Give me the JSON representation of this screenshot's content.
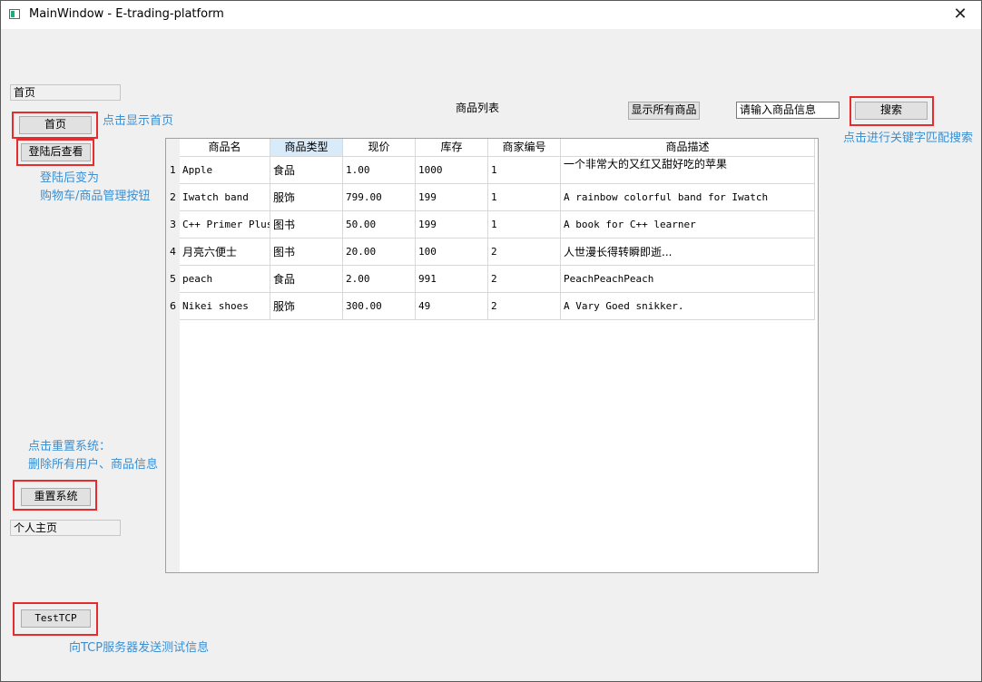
{
  "window": {
    "title": "MainWindow - E-trading-platform",
    "close_glyph": "✕"
  },
  "nav": {
    "home_group_label": "首页",
    "home_button": "首页",
    "login_view_button": "登陆后查看",
    "reset_button": "重置系统",
    "profile_group_label": "个人主页",
    "test_tcp_button": "TestTCP"
  },
  "annotations": {
    "home_hint": "点击显示首页",
    "login_hint_line1": "登陆后变为",
    "login_hint_line2": "购物车/商品管理按钮",
    "search_hint": "点击进行关键字匹配搜索",
    "reset_hint_line1": "点击重置系统：",
    "reset_hint_line2": "删除所有用户、商品信息",
    "tcp_hint": "向TCP服务器发送测试信息"
  },
  "toolbar": {
    "list_title": "商品列表",
    "show_all_button": "显示所有商品",
    "search_input_value": "请输入商品信息",
    "search_button": "搜索"
  },
  "table": {
    "headers": [
      "商品名",
      "商品类型",
      "现价",
      "库存",
      "商家编号",
      "商品描述"
    ],
    "row_numbers": [
      "1",
      "2",
      "3",
      "4",
      "5",
      "6"
    ],
    "rows": [
      [
        "Apple",
        "食品",
        "1.00",
        "1000",
        "1",
        "一个非常大的又红又甜好吃的苹果"
      ],
      [
        "Iwatch band",
        "服饰",
        "799.00",
        "199",
        "1",
        "A rainbow colorful band for Iwatch"
      ],
      [
        "C++ Primer Plus",
        "图书",
        "50.00",
        "199",
        "1",
        "A book for C++ learner"
      ],
      [
        "月亮六便士",
        "图书",
        "20.00",
        "100",
        "2",
        "人世漫长得转瞬即逝..."
      ],
      [
        "peach",
        "食品",
        "2.00",
        "991",
        "2",
        "PeachPeachPeach"
      ],
      [
        "Nikei shoes",
        "服饰",
        "300.00",
        "49",
        "2",
        "A Vary Goed snikker."
      ]
    ]
  },
  "colors": {
    "annotation": "#3a8fd3",
    "highlight_box": "#e52d2d",
    "selected_header": "#d9eaf9"
  }
}
